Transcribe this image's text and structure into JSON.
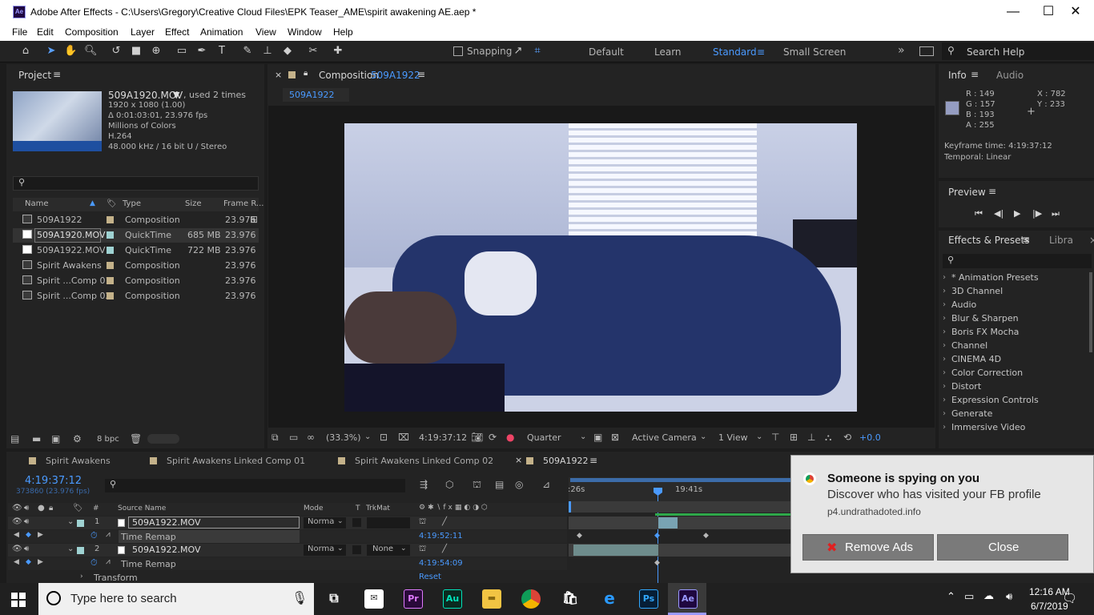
{
  "window": {
    "title": "Adobe After Effects - C:\\Users\\Gregory\\Creative Cloud Files\\EPK Teaser_AME\\spirit awakening AE.aep *",
    "app_icon": "Ae"
  },
  "menu": [
    "File",
    "Edit",
    "Composition",
    "Layer",
    "Effect",
    "Animation",
    "View",
    "Window",
    "Help"
  ],
  "toolbar": {
    "snapping": "Snapping",
    "workspaces": [
      "Default",
      "Learn",
      "Standard",
      "Small Screen"
    ],
    "search_help": "Search Help"
  },
  "project": {
    "tab": "Project",
    "footage": {
      "name": "509A1920.MOV",
      "used": ", used 2 times",
      "lines": [
        "1920 x 1080 (1.00)",
        "Δ 0:01:03:01, 23.976 fps",
        "Millions of Colors",
        "H.264",
        "48.000 kHz / 16 bit U / Stereo"
      ]
    },
    "columns": [
      "Name",
      "Type",
      "Size",
      "Frame R..."
    ],
    "items": [
      {
        "name": "509A1922",
        "type": "Composition",
        "size": "",
        "fps": "23.976",
        "color": "#c4b28a"
      },
      {
        "name": "509A1920.MOV",
        "type": "QuickTime",
        "size": "685 MB",
        "fps": "23.976",
        "color": "#9fd2d2"
      },
      {
        "name": "509A1922.MOV",
        "type": "QuickTime",
        "size": "722 MB",
        "fps": "23.976",
        "color": "#9fd2d2"
      },
      {
        "name": "Spirit Awakens",
        "type": "Composition",
        "size": "",
        "fps": "23.976",
        "color": "#c4b28a"
      },
      {
        "name": "Spirit ...Comp 01",
        "type": "Composition",
        "size": "",
        "fps": "23.976",
        "color": "#c4b28a"
      },
      {
        "name": "Spirit ...Comp 02",
        "type": "Composition",
        "size": "",
        "fps": "23.976",
        "color": "#c4b28a"
      }
    ],
    "bpc": "8 bpc"
  },
  "composition": {
    "tab_prefix": "Composition",
    "tab_name": "509A1922",
    "subtab": "509A1922",
    "zoom": "(33.3%)",
    "timecode": "4:19:37:12",
    "resolution": "Quarter",
    "camera": "Active Camera",
    "views": "1 View",
    "exposure": "+0.0"
  },
  "info": {
    "tabs": [
      "Info",
      "Audio"
    ],
    "rgba": [
      "R : 149",
      "G : 157",
      "B : 193",
      "A : 255"
    ],
    "xy": [
      "X : 782",
      "Y : 233"
    ],
    "swatch": "#959dc1",
    "keyframe_time": "Keyframe time: 4:19:37:12",
    "temporal": "Temporal: Linear"
  },
  "preview": {
    "tab": "Preview"
  },
  "effects": {
    "tab": "Effects & Presets",
    "tab2": "Libra",
    "items": [
      "* Animation Presets",
      "3D Channel",
      "Audio",
      "Blur & Sharpen",
      "Boris FX Mocha",
      "Channel",
      "CINEMA 4D",
      "Color Correction",
      "Distort",
      "Expression Controls",
      "Generate",
      "Immersive Video"
    ]
  },
  "timeline": {
    "tabs": [
      "Spirit Awakens",
      "Spirit Awakens Linked Comp 01",
      "Spirit Awakens Linked Comp 02",
      "509A1922"
    ],
    "timecode": "4:19:37:12",
    "frames": "373860 (23.976 fps)",
    "headers": {
      "source": "Source Name",
      "mode": "Mode",
      "t": "T",
      "trkmat": "TrkMat"
    },
    "rows": [
      {
        "num": "1",
        "name": "509A1922.MOV",
        "mode": "Norma",
        "trkmat": ""
      },
      {
        "prop": "Time Remap",
        "value": "4:19:52:11"
      },
      {
        "num": "2",
        "name": "509A1922.MOV",
        "mode": "Norma",
        "trkmat": "None"
      },
      {
        "prop": "Time Remap",
        "value": "4:19:54:09"
      },
      {
        "prop": "Transform",
        "value": "Reset"
      }
    ],
    "ruler": [
      ":26s",
      "19:41s"
    ]
  },
  "popup": {
    "title": "Someone is spying on you",
    "body": "Discover who has visited your FB profile",
    "domain": "p4.undrathadoted.info",
    "remove": "Remove Ads",
    "close": "Close"
  },
  "taskbar": {
    "search": "Type here to search",
    "time": "12:16 AM",
    "date": "6/7/2019"
  }
}
